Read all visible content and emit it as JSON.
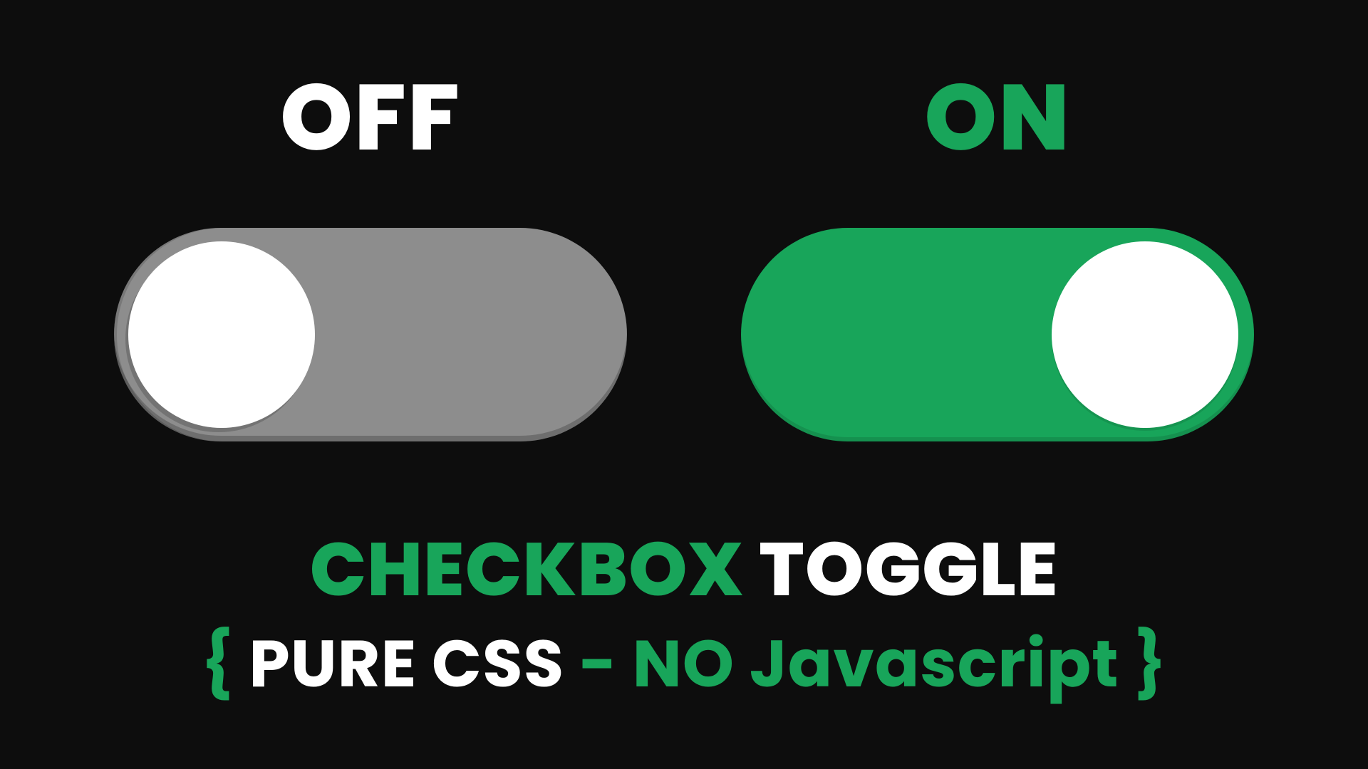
{
  "colors": {
    "background": "#0d0d0d",
    "green": "#18a55a",
    "white": "#ffffff",
    "switch_off_track": "#8d8d8d",
    "switch_on_track": "#18a55a",
    "knob": "#ffffff"
  },
  "toggles": {
    "off": {
      "label": "OFF",
      "state": false
    },
    "on": {
      "label": "ON",
      "state": true
    }
  },
  "caption": {
    "line1": {
      "word1": "CHECKBOX",
      "word2": "TOGGLE"
    },
    "line2": {
      "brace_open": "{",
      "part1": "PURE CSS",
      "dash": "-",
      "part2": "NO Javascript",
      "brace_close": "}"
    }
  }
}
